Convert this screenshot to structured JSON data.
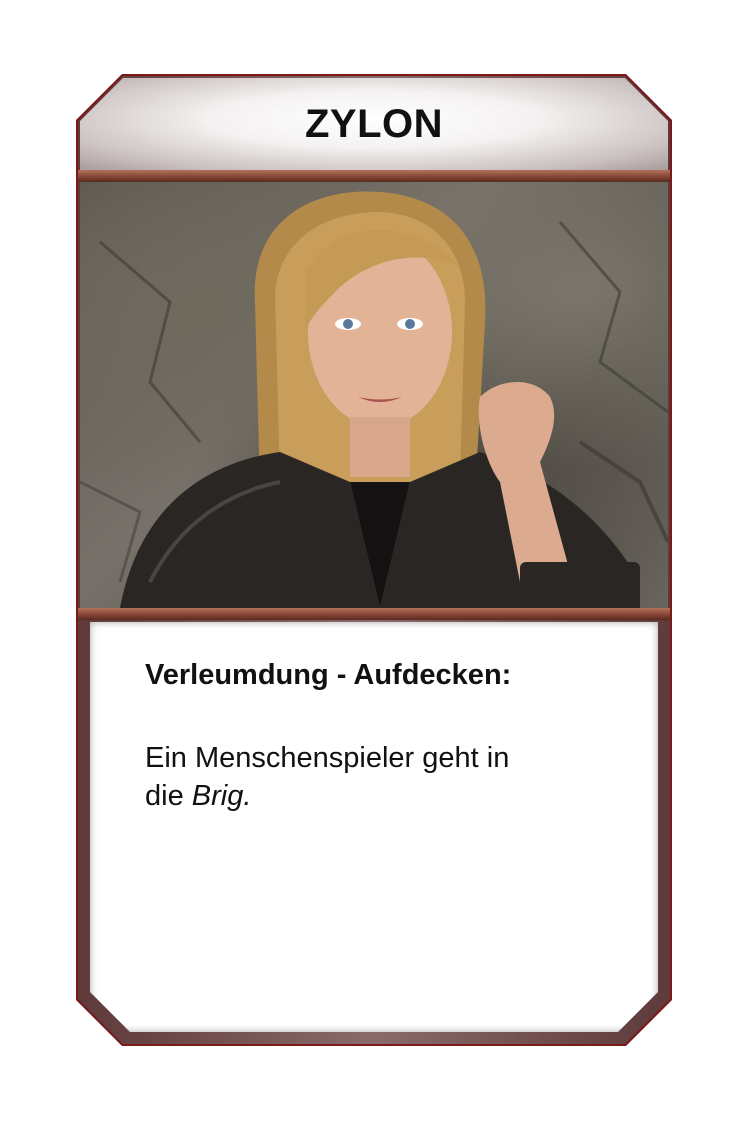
{
  "card": {
    "title": "ZYLON",
    "ability_title": "Verleumdung - Aufdecken:",
    "ability_text_line1": "Ein Menschenspieler geht in",
    "ability_text_line2_prefix": "die ",
    "ability_text_line2_italic": "Brig."
  },
  "colors": {
    "frame": "#7a1a1a",
    "rule": "#8a4a38",
    "text": "#111111"
  }
}
